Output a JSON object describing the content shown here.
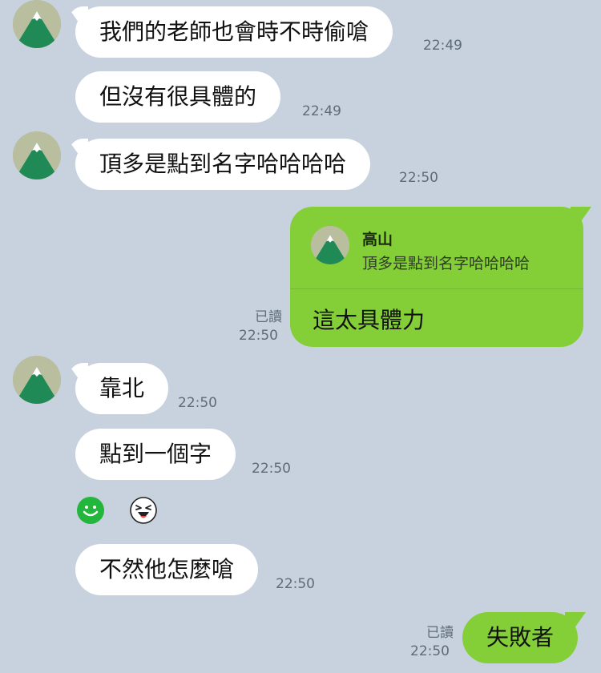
{
  "contact": {
    "name": "高山"
  },
  "messages": [
    {
      "text": "我們的老師也會時不時偷嗆",
      "time": "22:49"
    },
    {
      "text": "但沒有很具體的",
      "time": "22:49"
    },
    {
      "text": "頂多是點到名字哈哈哈哈",
      "time": "22:50"
    },
    {
      "quote_name": "高山",
      "quote_text": "頂多是點到名字哈哈哈哈",
      "text": "這太具體力",
      "read": "已讀",
      "time": "22:50"
    },
    {
      "text": "靠北",
      "time": "22:50"
    },
    {
      "text": "點到一個字",
      "time": "22:50"
    },
    {
      "text": "不然他怎麼嗆",
      "time": "22:50"
    },
    {
      "text": "失敗者",
      "read": "已讀",
      "time": "22:50"
    }
  ],
  "reactions": [
    {
      "icon": "green-smiley-icon"
    },
    {
      "icon": "laughing-face-icon"
    }
  ],
  "colors": {
    "background": "#c7d2de",
    "incoming_bubble": "#ffffff",
    "outgoing_bubble": "#84cf38",
    "timestamp": "#5f6b78"
  }
}
